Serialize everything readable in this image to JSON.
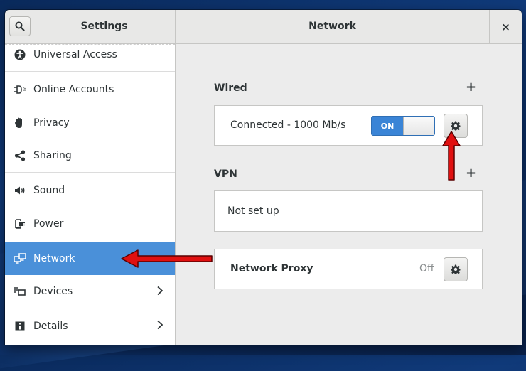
{
  "window": {
    "sidebar_title": "Settings",
    "panel_title": "Network",
    "close_label": "×"
  },
  "sidebar": {
    "items": [
      {
        "label": "Universal Access",
        "icon": "universal-access-icon"
      },
      {
        "label": "Online Accounts",
        "icon": "online-accounts-icon"
      },
      {
        "label": "Privacy",
        "icon": "privacy-hand-icon"
      },
      {
        "label": "Sharing",
        "icon": "sharing-icon"
      },
      {
        "label": "Sound",
        "icon": "speaker-icon"
      },
      {
        "label": "Power",
        "icon": "power-plug-icon"
      },
      {
        "label": "Network",
        "icon": "network-icon",
        "selected": true
      },
      {
        "label": "Devices",
        "icon": "devices-icon",
        "has_submenu": true
      },
      {
        "label": "Details",
        "icon": "info-icon",
        "has_submenu": true
      }
    ]
  },
  "network": {
    "wired": {
      "title": "Wired",
      "add_label": "+",
      "status": "Connected - 1000 Mb/s",
      "switch_label": "ON"
    },
    "vpn": {
      "title": "VPN",
      "add_label": "+",
      "status": "Not set up"
    },
    "proxy": {
      "title": "Network Proxy",
      "status": "Off"
    }
  },
  "colors": {
    "selected_bg": "#4a90d9",
    "switch_on": "#3a84d6",
    "annotation_arrow": "#e01010"
  }
}
